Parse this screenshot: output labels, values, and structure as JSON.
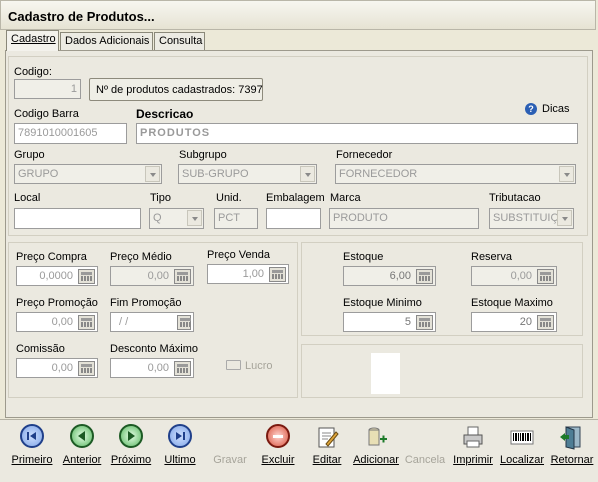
{
  "window": {
    "title": "Cadastro de Produtos..."
  },
  "tabs": [
    {
      "label": "Cadastro"
    },
    {
      "label": "Dados Adicionais"
    },
    {
      "label": "Consulta"
    }
  ],
  "form": {
    "codigo_label": "Codigo:",
    "codigo_value": "1",
    "count_button": "Nº de produtos cadastrados: 7397",
    "dicas": "Dicas",
    "codigo_barra_label": "Codigo Barra",
    "codigo_barra_value": "7891010001605",
    "descricao_label": "Descricao",
    "descricao_value": "PRODUTOS",
    "grupo_label": "Grupo",
    "grupo_value": "GRUPO",
    "subgrupo_label": "Subgrupo",
    "subgrupo_value": "SUB-GRUPO",
    "fornecedor_label": "Fornecedor",
    "fornecedor_value": "FORNECEDOR",
    "local_label": "Local",
    "local_value": "",
    "tipo_label": "Tipo",
    "tipo_value": "Q",
    "unid_label": "Unid.",
    "unid_value": "PCT",
    "embalagem_label": "Embalagem",
    "embalagem_value": "",
    "marca_label": "Marca",
    "marca_value": "PRODUTO",
    "tributacao_label": "Tributacao",
    "tributacao_value": "SUBSTITUIÇ"
  },
  "prices": {
    "preco_compra_label": "Preço Compra",
    "preco_compra_value": "0,0000",
    "preco_medio_label": "Preço Médio",
    "preco_medio_value": "0,00",
    "preco_venda_label": "Preço Venda",
    "preco_venda_value": "1,00",
    "preco_promocao_label": "Preço Promoção",
    "preco_promocao_value": "0,00",
    "fim_promocao_label": "Fim Promoção",
    "fim_promocao_value": "/  /",
    "comissao_label": "Comissão",
    "comissao_value": "0,00",
    "desconto_label": "Desconto Máximo",
    "desconto_value": "0,00",
    "lucro_label": "Lucro"
  },
  "stock": {
    "estoque_label": "Estoque",
    "estoque_value": "6,00",
    "reserva_label": "Reserva",
    "reserva_value": "0,00",
    "estoque_minimo_label": "Estoque Minimo",
    "estoque_minimo_value": "5",
    "estoque_maximo_label": "Estoque Maximo",
    "estoque_maximo_value": "20"
  },
  "toolbar": {
    "primeiro": "Primeiro",
    "anterior": "Anterior",
    "proximo": "Próximo",
    "ultimo": "Ultimo",
    "gravar": "Gravar",
    "excluir": "Excluir",
    "editar": "Editar",
    "adicionar": "Adicionar",
    "cancela": "Cancela",
    "imprimir": "Imprimir",
    "localizar": "Localizar",
    "retornar": "Retornar"
  },
  "colors": {
    "nav_blue": "#1f3f8a",
    "nav_green": "#1c7a2a",
    "delete_red": "#b22a1a",
    "window_bg": "#ece9d8"
  }
}
